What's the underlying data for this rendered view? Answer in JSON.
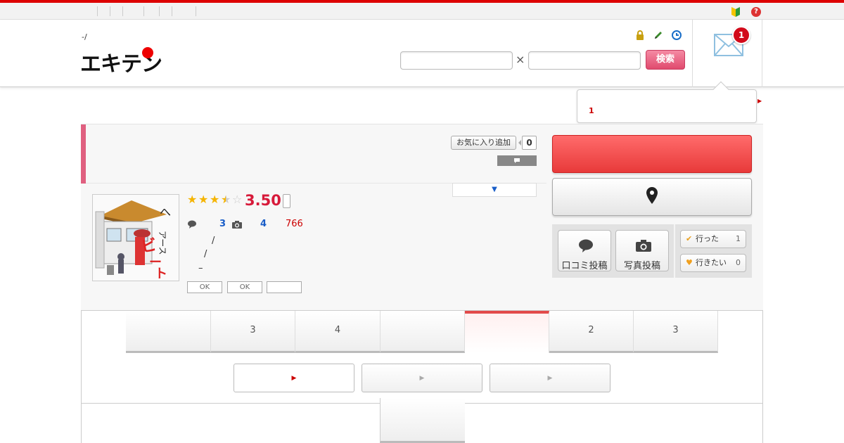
{
  "colors": {
    "accent": "#d00000",
    "rating": "#d71a3a",
    "link": "#1a5ec8",
    "primary_button": "#e83a3a"
  },
  "header": {
    "sub_title": "-/",
    "logo_text": "エキテン",
    "search": {
      "left_value": "",
      "right_value": "",
      "joiner": "×",
      "button_label": "検索"
    },
    "icons": [
      "lock-icon",
      "pencil-icon",
      "history-icon"
    ],
    "mail": {
      "badge_count": "1"
    }
  },
  "notification_popup": {
    "count": "1"
  },
  "shop": {
    "favorite_label": "お気に入り追加",
    "favorite_count": "0",
    "rating": {
      "stars": 3.5,
      "score": "3.50"
    },
    "review_count": "3",
    "photo_count": "4",
    "access_count": "766",
    "lines": [
      "/",
      "/",
      "–"
    ],
    "ok_buttons": [
      "OK",
      "OK",
      ""
    ]
  },
  "actions": {
    "review_post_label": "口コミ投稿",
    "photo_post_label": "写真投稿",
    "visited": {
      "label": "行った",
      "count": "1"
    },
    "want_to_go": {
      "label": "行きたい",
      "count": "0"
    }
  },
  "tabs": [
    {
      "label": ""
    },
    {
      "label": "3"
    },
    {
      "label": "4"
    },
    {
      "label": ""
    },
    {
      "label": "",
      "active": true
    },
    {
      "label": "2"
    },
    {
      "label": "3"
    }
  ],
  "sub_pills": [
    {
      "label": "▶"
    },
    {
      "label": "▶"
    },
    {
      "label": "▶"
    }
  ]
}
